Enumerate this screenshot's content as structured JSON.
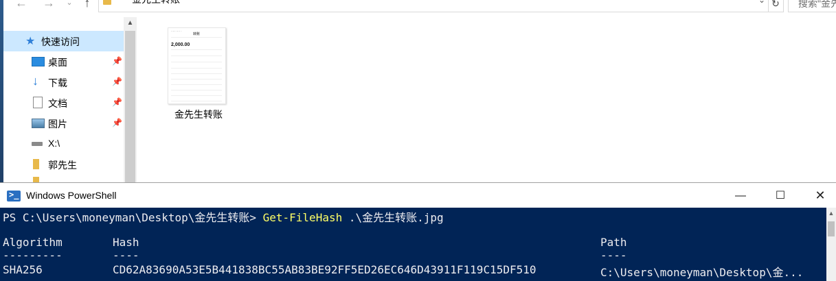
{
  "explorer": {
    "address_path": "金先生转账",
    "search_placeholder": "搜索\"金先",
    "nav": [
      {
        "label": "快速访问",
        "icon": "star-icon",
        "selected": true,
        "pinned": false
      },
      {
        "label": "桌面",
        "icon": "desktop-icon",
        "pinned": true
      },
      {
        "label": "下载",
        "icon": "download-icon",
        "pinned": true
      },
      {
        "label": "文档",
        "icon": "document-icon",
        "pinned": true
      },
      {
        "label": "图片",
        "icon": "pictures-icon",
        "pinned": true
      },
      {
        "label": "X:\\",
        "icon": "network-drive-icon",
        "pinned": false
      },
      {
        "label": "郭先生",
        "icon": "folder-icon",
        "pinned": false
      }
    ],
    "file": {
      "name": "金先生转账",
      "thumbnail": {
        "header": "转账",
        "amount": "2,000.00"
      }
    }
  },
  "powershell": {
    "title": "Windows PowerShell",
    "prompt": "PS C:\\Users\\moneyman\\Desktop\\金先生转账> ",
    "command": "Get-FileHash",
    "argument": " .\\金先生转账.jpg",
    "table": {
      "headers": [
        "Algorithm",
        "Hash",
        "Path"
      ],
      "separators": [
        "---------",
        "----",
        "----"
      ],
      "rows": [
        [
          "SHA256",
          "CD62A83690A53E5B441838BC55AB83BE92FF5ED26EC646D43911F119C15DF510",
          "C:\\Users\\moneyman\\Desktop\\金..."
        ]
      ]
    },
    "colors": {
      "background": "#012456",
      "text": "#eeedf0",
      "command": "#ffff66"
    }
  }
}
